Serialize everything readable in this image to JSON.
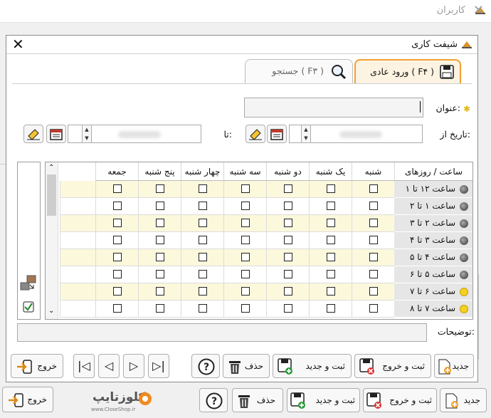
{
  "outer_window": {
    "title": "کاربران"
  },
  "dialog": {
    "title": "شیفت کاری"
  },
  "tabs": [
    {
      "label": "ورود عادی ( F۴ )",
      "active": true
    },
    {
      "label": "جستجو ( F۳ )",
      "active": false
    }
  ],
  "form": {
    "title_label": "عنوان:",
    "title_value": "",
    "date_from_label": "تاریخ از:",
    "date_to_label": "تا:"
  },
  "grid": {
    "header_corner": "ساعت / روزهای",
    "days": [
      "شنبه",
      "یک شنبه",
      "دو شنبه",
      "سه شنبه",
      "چهار شنبه",
      "پنج شنبه",
      "جمعه"
    ],
    "rows": [
      {
        "label": "ساعت ۱۲ تا ۱",
        "icon": "dark"
      },
      {
        "label": "ساعت ۱ تا ۲",
        "icon": "dark"
      },
      {
        "label": "ساعت ۲ تا ۳",
        "icon": "dark"
      },
      {
        "label": "ساعت ۳ تا ۴",
        "icon": "dark"
      },
      {
        "label": "ساعت ۴ تا ۵",
        "icon": "dark"
      },
      {
        "label": "ساعت ۵ تا ۶",
        "icon": "dark"
      },
      {
        "label": "ساعت ۶ تا ۷",
        "icon": "sun"
      },
      {
        "label": "ساعت ۷ تا ۸",
        "icon": "sun"
      }
    ]
  },
  "notes": {
    "label": "توضیحات:",
    "value": ""
  },
  "dialog_buttons": {
    "new": "جدید",
    "save_exit": "ثبت و خروج",
    "save_new": "ثبت و جدید",
    "delete": "حذف",
    "exit": "خروج"
  },
  "outer_buttons": {
    "new": "جدید",
    "save_exit": "ثبت و خروج",
    "save_new": "ثبت و جدید",
    "delete": "حذف",
    "exit": "خروج"
  },
  "watermark": {
    "brand": "کلوزتایپ",
    "site": "www.CloseShop.ir"
  },
  "colors": {
    "accent_tab": "#f0a030",
    "row_highlight": "#fbf8dc",
    "checkbox_green": "#2e8b2e"
  }
}
